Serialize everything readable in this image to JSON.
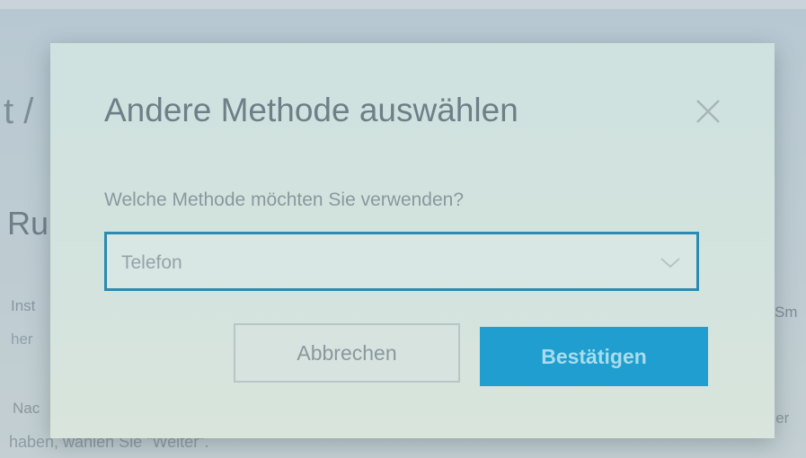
{
  "background": {
    "heading_fragment": "t /",
    "subheading_fragment": "Ru",
    "line_1_fragment": "Inst",
    "line_2_fragment": "her",
    "line_3_fragment": "Nac",
    "line_4": "haben, wählen Sie \"Weiter\".",
    "right_fragment_1": "Sm",
    "right_fragment_2": "Ger"
  },
  "dialog": {
    "title": "Andere Methode auswählen",
    "close_icon": "close-icon",
    "question_label": "Welche Methode möchten Sie verwenden?",
    "method_select": {
      "selected_value": "Telefon",
      "icon": "chevron-down-icon"
    },
    "cancel_label": "Abbrechen",
    "confirm_label": "Bestätigen"
  },
  "colors": {
    "accent": "#1f9ecf",
    "select_border": "#2b8bb0",
    "dialog_background": "#d3e3de"
  }
}
